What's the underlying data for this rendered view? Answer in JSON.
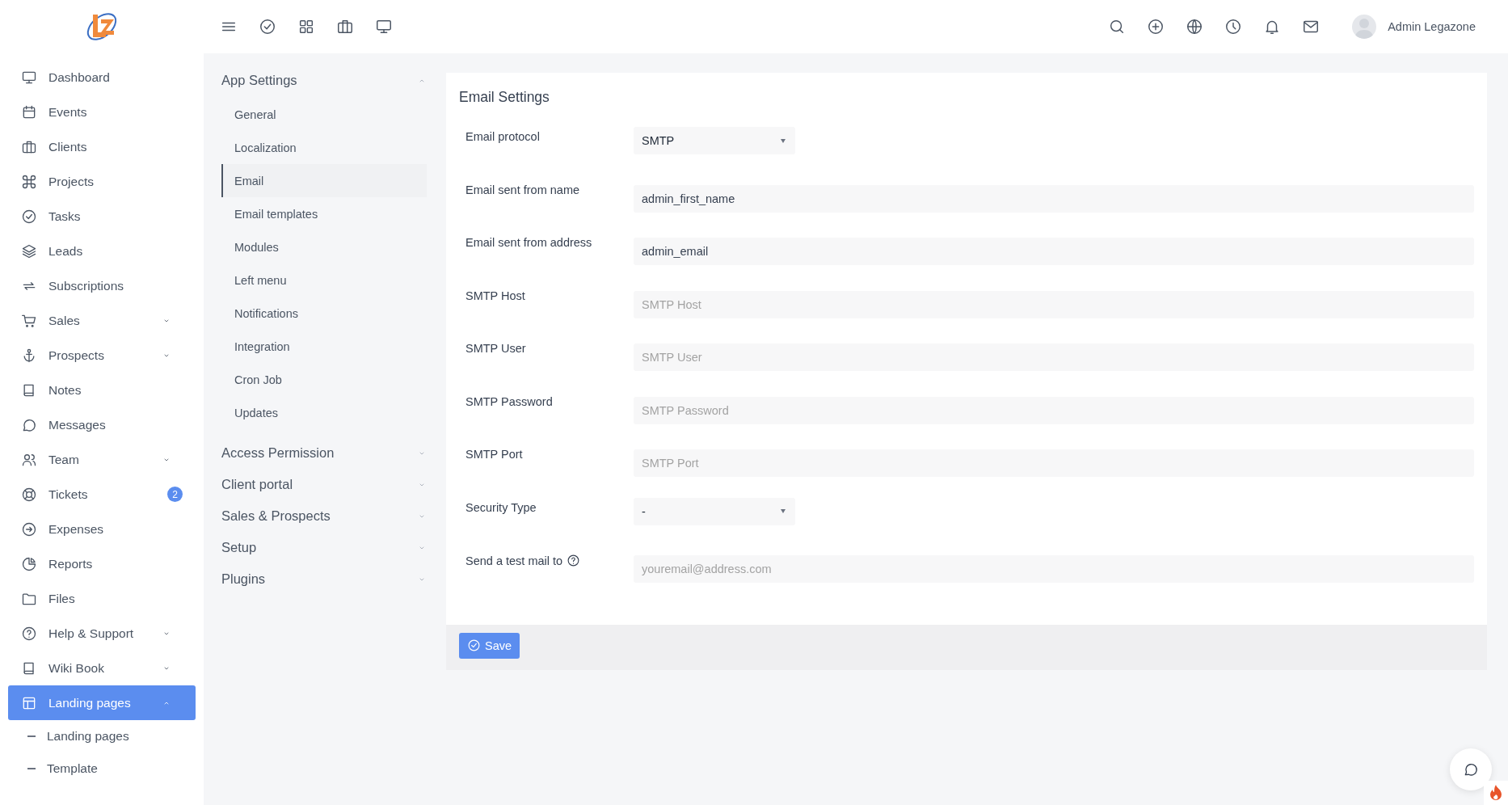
{
  "header": {
    "user_name": "Admin Legazone"
  },
  "sidebar": {
    "items": [
      {
        "label": "Dashboard",
        "kind": "link",
        "selected": false
      },
      {
        "label": "Events",
        "kind": "link",
        "selected": false
      },
      {
        "label": "Clients",
        "kind": "link",
        "selected": false
      },
      {
        "label": "Projects",
        "kind": "link",
        "selected": false
      },
      {
        "label": "Tasks",
        "kind": "link",
        "selected": false
      },
      {
        "label": "Leads",
        "kind": "link",
        "selected": false
      },
      {
        "label": "Subscriptions",
        "kind": "link",
        "selected": false
      },
      {
        "label": "Sales",
        "kind": "group",
        "expanded": false,
        "selected": false
      },
      {
        "label": "Prospects",
        "kind": "group",
        "expanded": false,
        "selected": false
      },
      {
        "label": "Notes",
        "kind": "link",
        "selected": false
      },
      {
        "label": "Messages",
        "kind": "link",
        "selected": false
      },
      {
        "label": "Team",
        "kind": "group",
        "expanded": false,
        "selected": false
      },
      {
        "label": "Tickets",
        "kind": "link",
        "selected": false,
        "badge": "2"
      },
      {
        "label": "Expenses",
        "kind": "link",
        "selected": false
      },
      {
        "label": "Reports",
        "kind": "link",
        "selected": false
      },
      {
        "label": "Files",
        "kind": "link",
        "selected": false
      },
      {
        "label": "Help & Support",
        "kind": "group",
        "expanded": false,
        "selected": false
      },
      {
        "label": "Wiki Book",
        "kind": "group",
        "expanded": false,
        "selected": false
      },
      {
        "label": "Landing pages",
        "kind": "group",
        "expanded": true,
        "selected": true,
        "children": [
          {
            "label": "Landing pages"
          },
          {
            "label": "Template"
          }
        ]
      }
    ]
  },
  "settings_menu": [
    {
      "title": "App Settings",
      "expanded": true,
      "items": [
        {
          "label": "General",
          "selected": false
        },
        {
          "label": "Localization",
          "selected": false
        },
        {
          "label": "Email",
          "selected": true
        },
        {
          "label": "Email templates",
          "selected": false
        },
        {
          "label": "Modules",
          "selected": false
        },
        {
          "label": "Left menu",
          "selected": false
        },
        {
          "label": "Notifications",
          "selected": false
        },
        {
          "label": "Integration",
          "selected": false
        },
        {
          "label": "Cron Job",
          "selected": false
        },
        {
          "label": "Updates",
          "selected": false
        }
      ]
    },
    {
      "title": "Access Permission",
      "expanded": false
    },
    {
      "title": "Client portal",
      "expanded": false
    },
    {
      "title": "Sales & Prospects",
      "expanded": false
    },
    {
      "title": "Setup",
      "expanded": false
    },
    {
      "title": "Plugins",
      "expanded": false
    }
  ],
  "email_settings": {
    "title": "Email Settings",
    "fields": [
      {
        "label": "Email protocol",
        "kind": "select",
        "value": "SMTP",
        "help": false
      },
      {
        "label": "Email sent from name",
        "kind": "text",
        "value": "admin_first_name",
        "help": false
      },
      {
        "label": "Email sent from address",
        "kind": "text",
        "value": "admin_email",
        "help": false
      },
      {
        "label": "SMTP Host",
        "kind": "text",
        "placeholder": "SMTP Host",
        "help": false
      },
      {
        "label": "SMTP User",
        "kind": "text",
        "placeholder": "SMTP User",
        "help": false
      },
      {
        "label": "SMTP Password",
        "kind": "text",
        "placeholder": "SMTP Password",
        "help": false
      },
      {
        "label": "SMTP Port",
        "kind": "text",
        "placeholder": "SMTP Port",
        "help": false
      },
      {
        "label": "Security Type",
        "kind": "select",
        "value": "-",
        "help": false
      },
      {
        "label": "Send a test mail to",
        "kind": "text",
        "placeholder": "youremail@address.com",
        "help": true
      }
    ],
    "save_label": "Save"
  }
}
